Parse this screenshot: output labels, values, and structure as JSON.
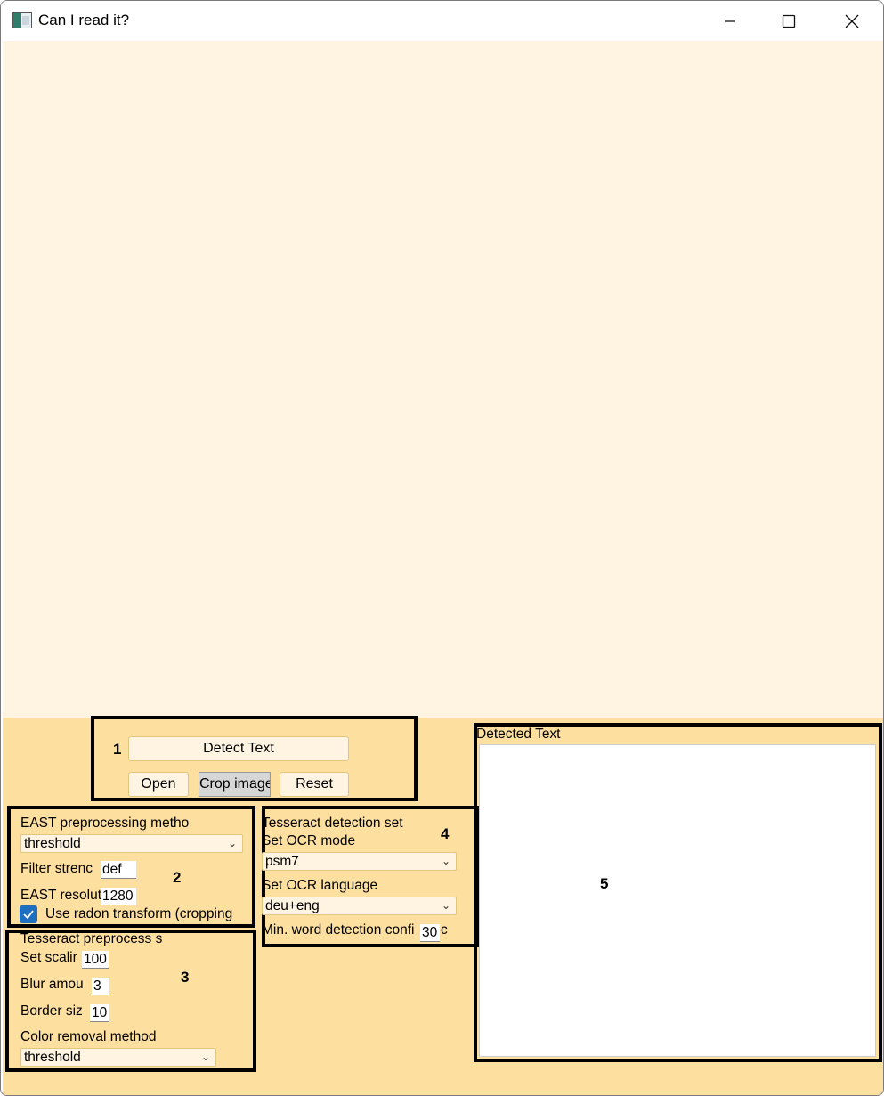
{
  "window": {
    "title": "Can I read it?",
    "controls": {
      "minimize": "—",
      "maximize": "□",
      "close": "✕"
    }
  },
  "annotations": {
    "n1": "1",
    "n2": "2",
    "n3": "3",
    "n4": "4",
    "n5": "5"
  },
  "section1": {
    "detect_button": "Detect Text",
    "open_button": "Open",
    "crop_button": "Crop image",
    "reset_button": "Reset"
  },
  "section2": {
    "method_label": "EAST preprocessing metho",
    "method_value": "threshold",
    "filter_label": "Filter strenc",
    "filter_value": "def",
    "resolution_label": "EAST resolut",
    "resolution_value": "1280",
    "radon_label": "Use radon transform (cropping",
    "radon_checked": true
  },
  "section3": {
    "title": "Tesseract preprocess s",
    "scaling_label": "Set scalir",
    "scaling_value": "100",
    "blur_label": "Blur amou",
    "blur_value": "3",
    "border_label": "Border siz",
    "border_value": "10",
    "color_label": "Color removal method",
    "color_value": "threshold"
  },
  "section4": {
    "title": "Tesseract detection set",
    "mode_label": "Set OCR mode",
    "mode_value": "psm7",
    "language_label": "Set OCR language",
    "language_value": "deu+eng",
    "confidence_label": "Min. word detection confi",
    "confidence_suffix": "c",
    "confidence_value": "30"
  },
  "section5": {
    "title": "Detected Text",
    "text": ""
  },
  "colors": {
    "canvas_bg": "#fef4e1",
    "panel_bg": "#fddf9f",
    "highlight_border": "#000000",
    "checkbox_accent": "#1f6fc0"
  }
}
